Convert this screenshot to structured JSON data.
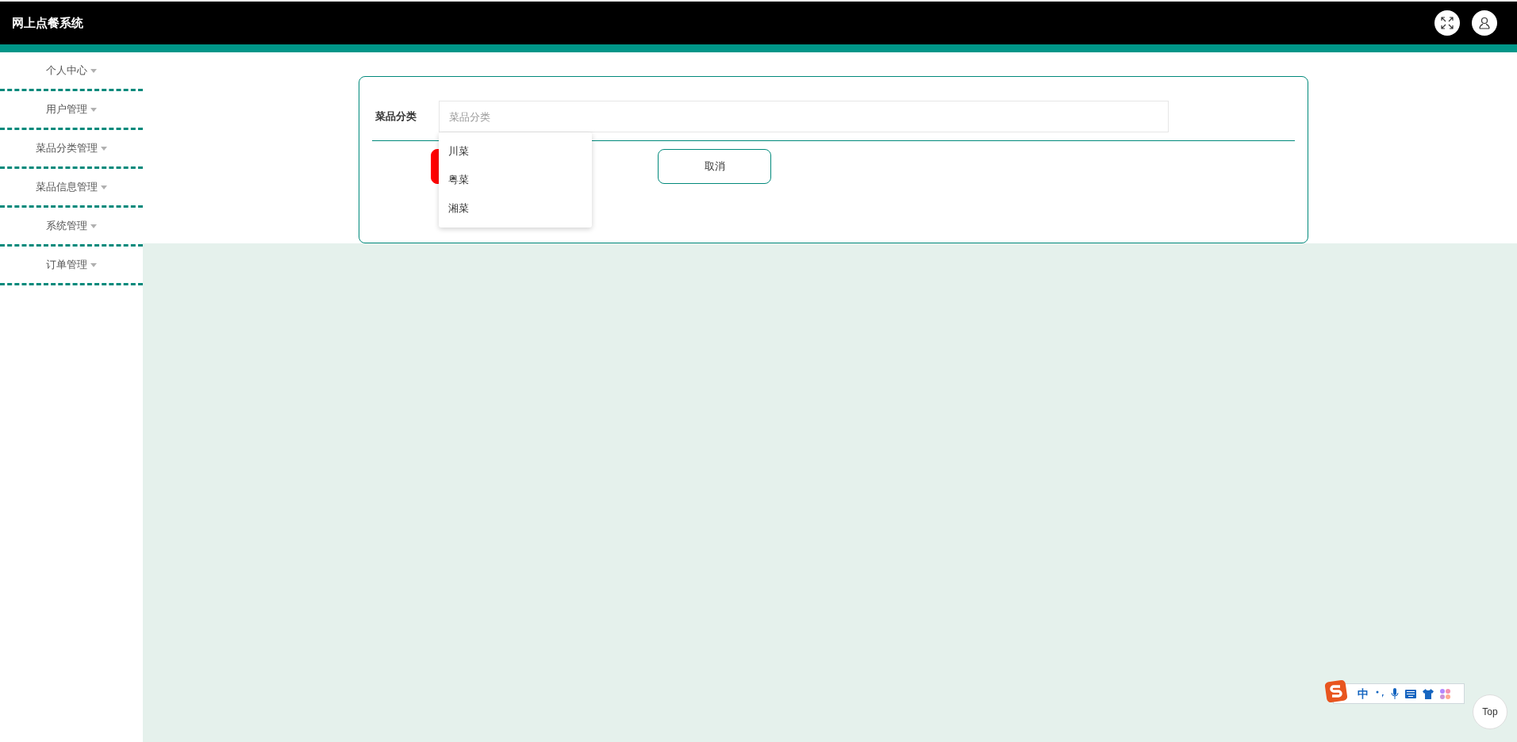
{
  "header": {
    "title": "网上点餐系统"
  },
  "sidebar": {
    "items": [
      {
        "label": "个人中心"
      },
      {
        "label": "用户管理"
      },
      {
        "label": "菜品分类管理"
      },
      {
        "label": "菜品信息管理"
      },
      {
        "label": "系统管理"
      },
      {
        "label": "订单管理"
      }
    ]
  },
  "form": {
    "field": {
      "label": "菜品分类",
      "placeholder": "菜品分类"
    },
    "dropdown": {
      "options": [
        "川菜",
        "粤菜",
        "湘菜"
      ]
    },
    "buttons": [
      {
        "kind": "submit"
      },
      {
        "kind": "cancel",
        "label": "取消"
      }
    ]
  },
  "ime_toolbar": {
    "mode": "中"
  },
  "back_to_top": {
    "label": "Top"
  }
}
